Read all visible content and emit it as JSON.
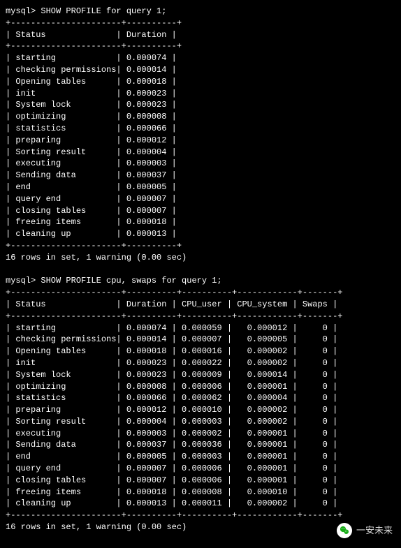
{
  "query1": {
    "prompt": "mysql> ",
    "command": "SHOW PROFILE for query 1;",
    "columns": [
      "Status",
      "Duration"
    ],
    "rows": [
      {
        "status": "starting",
        "duration": "0.000074"
      },
      {
        "status": "checking permissions",
        "duration": "0.000014"
      },
      {
        "status": "Opening tables",
        "duration": "0.000018"
      },
      {
        "status": "init",
        "duration": "0.000023"
      },
      {
        "status": "System lock",
        "duration": "0.000023"
      },
      {
        "status": "optimizing",
        "duration": "0.000008"
      },
      {
        "status": "statistics",
        "duration": "0.000066"
      },
      {
        "status": "preparing",
        "duration": "0.000012"
      },
      {
        "status": "Sorting result",
        "duration": "0.000004"
      },
      {
        "status": "executing",
        "duration": "0.000003"
      },
      {
        "status": "Sending data",
        "duration": "0.000037"
      },
      {
        "status": "end",
        "duration": "0.000005"
      },
      {
        "status": "query end",
        "duration": "0.000007"
      },
      {
        "status": "closing tables",
        "duration": "0.000007"
      },
      {
        "status": "freeing items",
        "duration": "0.000018"
      },
      {
        "status": "cleaning up",
        "duration": "0.000013"
      }
    ],
    "footer": "16 rows in set, 1 warning (0.00 sec)"
  },
  "query2": {
    "prompt": "mysql> ",
    "command": "SHOW PROFILE cpu, swaps for query 1;",
    "columns": [
      "Status",
      "Duration",
      "CPU_user",
      "CPU_system",
      "Swaps"
    ],
    "rows": [
      {
        "status": "starting",
        "duration": "0.000074",
        "cpu_user": "0.000059",
        "cpu_system": "0.000012",
        "swaps": "0"
      },
      {
        "status": "checking permissions",
        "duration": "0.000014",
        "cpu_user": "0.000007",
        "cpu_system": "0.000005",
        "swaps": "0"
      },
      {
        "status": "Opening tables",
        "duration": "0.000018",
        "cpu_user": "0.000016",
        "cpu_system": "0.000002",
        "swaps": "0"
      },
      {
        "status": "init",
        "duration": "0.000023",
        "cpu_user": "0.000022",
        "cpu_system": "0.000002",
        "swaps": "0"
      },
      {
        "status": "System lock",
        "duration": "0.000023",
        "cpu_user": "0.000009",
        "cpu_system": "0.000014",
        "swaps": "0"
      },
      {
        "status": "optimizing",
        "duration": "0.000008",
        "cpu_user": "0.000006",
        "cpu_system": "0.000001",
        "swaps": "0"
      },
      {
        "status": "statistics",
        "duration": "0.000066",
        "cpu_user": "0.000062",
        "cpu_system": "0.000004",
        "swaps": "0"
      },
      {
        "status": "preparing",
        "duration": "0.000012",
        "cpu_user": "0.000010",
        "cpu_system": "0.000002",
        "swaps": "0"
      },
      {
        "status": "Sorting result",
        "duration": "0.000004",
        "cpu_user": "0.000003",
        "cpu_system": "0.000002",
        "swaps": "0"
      },
      {
        "status": "executing",
        "duration": "0.000003",
        "cpu_user": "0.000002",
        "cpu_system": "0.000001",
        "swaps": "0"
      },
      {
        "status": "Sending data",
        "duration": "0.000037",
        "cpu_user": "0.000036",
        "cpu_system": "0.000001",
        "swaps": "0"
      },
      {
        "status": "end",
        "duration": "0.000005",
        "cpu_user": "0.000003",
        "cpu_system": "0.000001",
        "swaps": "0"
      },
      {
        "status": "query end",
        "duration": "0.000007",
        "cpu_user": "0.000006",
        "cpu_system": "0.000001",
        "swaps": "0"
      },
      {
        "status": "closing tables",
        "duration": "0.000007",
        "cpu_user": "0.000006",
        "cpu_system": "0.000001",
        "swaps": "0"
      },
      {
        "status": "freeing items",
        "duration": "0.000018",
        "cpu_user": "0.000008",
        "cpu_system": "0.000010",
        "swaps": "0"
      },
      {
        "status": "cleaning up",
        "duration": "0.000013",
        "cpu_user": "0.000011",
        "cpu_system": "0.000002",
        "swaps": "0"
      }
    ],
    "footer": "16 rows in set, 1 warning (0.00 sec)"
  },
  "watermark": {
    "text": "一安未来"
  }
}
